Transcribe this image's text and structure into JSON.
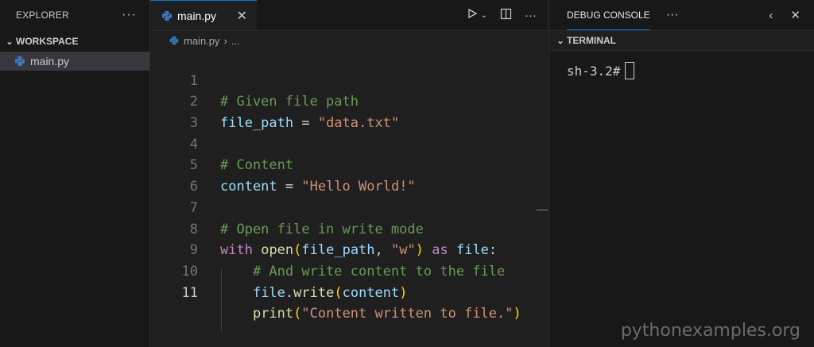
{
  "explorer": {
    "title": "EXPLORER",
    "more": "···",
    "workspace_label": "WORKSPACE",
    "files": [
      {
        "name": "main.py"
      }
    ]
  },
  "editor": {
    "tab_label": "main.py",
    "tab_close": "✕",
    "breadcrumb_file": "main.py",
    "breadcrumb_rest": "...",
    "line_numbers": [
      "1",
      "2",
      "3",
      "4",
      "5",
      "6",
      "7",
      "8",
      "9",
      "10",
      "11"
    ],
    "active_line": 11,
    "code": {
      "l1_comment": "# Given file path",
      "l2_var": "file_path",
      "l2_op": " = ",
      "l2_str": "\"data.txt\"",
      "l4_comment": "# Content",
      "l5_var": "content",
      "l5_op": " = ",
      "l5_str": "\"Hello World!\"",
      "l7_comment": "# Open file in write mode",
      "l8_with": "with",
      "l8_open": "open",
      "l8_lp": "(",
      "l8_arg": "file_path",
      "l8_comma": ", ",
      "l8_str": "\"w\"",
      "l8_rp": ")",
      "l8_as": "as",
      "l8_file": "file",
      "l8_colon": ":",
      "l9_comment": "# And write content to the file",
      "l10_obj": "file",
      "l10_dot": ".",
      "l10_fn": "write",
      "l10_lp": "(",
      "l10_arg": "content",
      "l10_rp": ")",
      "l11_fn": "print",
      "l11_lp": "(",
      "l11_str": "\"Content written to file.\"",
      "l11_rp": ")"
    }
  },
  "panel": {
    "tab_label": "DEBUG CONSOLE",
    "more": "···",
    "terminal_label": "TERMINAL",
    "prompt": "sh-3.2#"
  },
  "watermark": "pythonexamples.org",
  "colors": {
    "accent": "#0078d4",
    "comment": "#6a9955",
    "variable": "#9cdcfe",
    "string": "#ce9178",
    "keyword": "#c586c0",
    "function": "#dcdcaa"
  }
}
